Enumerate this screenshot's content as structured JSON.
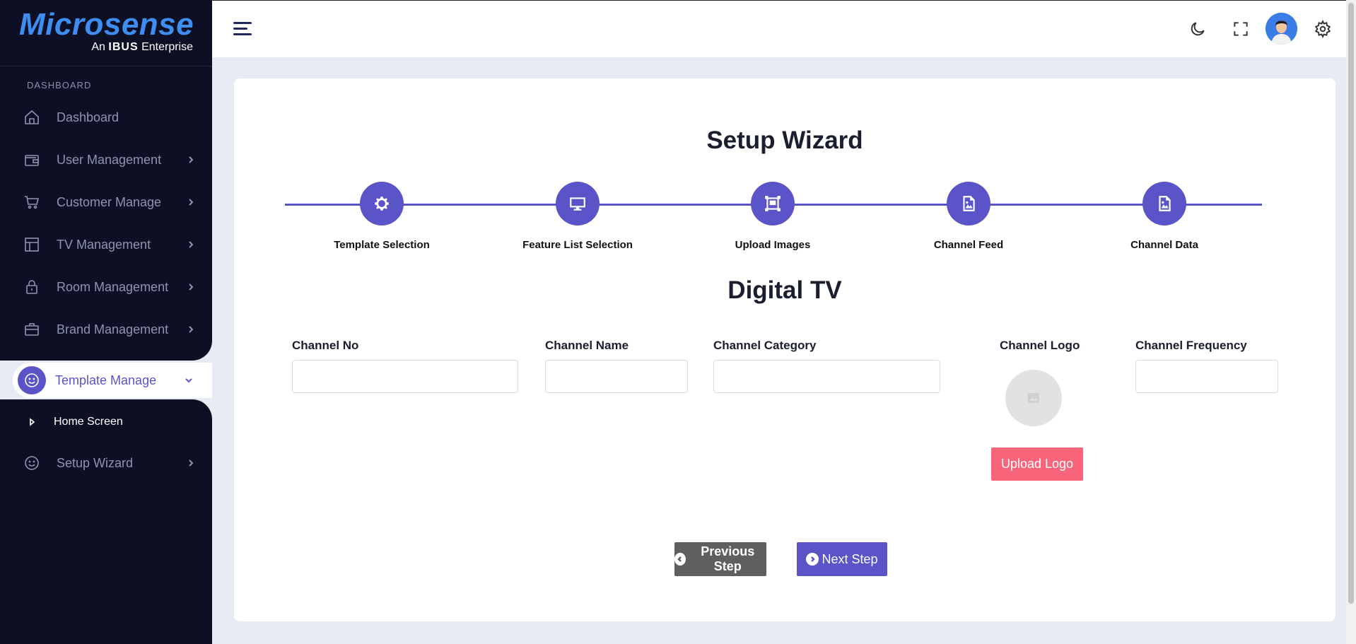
{
  "brand": {
    "name": "Microsense",
    "tagline_prefix": "An",
    "tagline_brand": "IBUS",
    "tagline_suffix": "Enterprise"
  },
  "sidebar": {
    "heading": "DASHBOARD",
    "items": [
      {
        "label": "Dashboard",
        "icon": "home-icon"
      },
      {
        "label": "User Management",
        "icon": "wallet-icon"
      },
      {
        "label": "Customer Manage",
        "icon": "cart-icon"
      },
      {
        "label": "TV Management",
        "icon": "layout-icon"
      },
      {
        "label": "Room Management",
        "icon": "lock-icon"
      },
      {
        "label": "Brand Management",
        "icon": "briefcase-icon"
      }
    ],
    "active": {
      "label": "Template Manage",
      "icon": "smile-icon"
    },
    "sub_items": [
      {
        "label": "Home Screen"
      }
    ],
    "after": [
      {
        "label": "Setup Wizard",
        "icon": "smile-icon"
      }
    ]
  },
  "header": {
    "icons": [
      "menu-icon",
      "moon-icon",
      "fullscreen-icon",
      "avatar",
      "gear-icon"
    ]
  },
  "wizard": {
    "title": "Setup Wizard",
    "steps": [
      {
        "label": "Template Selection",
        "icon": "gear-icon"
      },
      {
        "label": "Feature List Selection",
        "icon": "monitor-icon"
      },
      {
        "label": "Upload Images",
        "icon": "images-icon"
      },
      {
        "label": "Channel Feed",
        "icon": "image-icon"
      },
      {
        "label": "Channel Data",
        "icon": "image-icon"
      }
    ]
  },
  "form": {
    "section_title": "Digital TV",
    "channel_no": {
      "label": "Channel No",
      "value": ""
    },
    "channel_name": {
      "label": "Channel Name",
      "value": ""
    },
    "channel_category": {
      "label": "Channel Category",
      "value": ""
    },
    "channel_logo": {
      "label": "Channel Logo",
      "upload_label": "Upload Logo"
    },
    "channel_frequency": {
      "label": "Channel Frequency",
      "value": ""
    }
  },
  "actions": {
    "previous": "Previous Step",
    "next": "Next Step"
  },
  "colors": {
    "accent": "#5b54c8",
    "sidebar_bg": "#0d1024",
    "upload": "#f8647a",
    "prev": "#5f5f62"
  }
}
